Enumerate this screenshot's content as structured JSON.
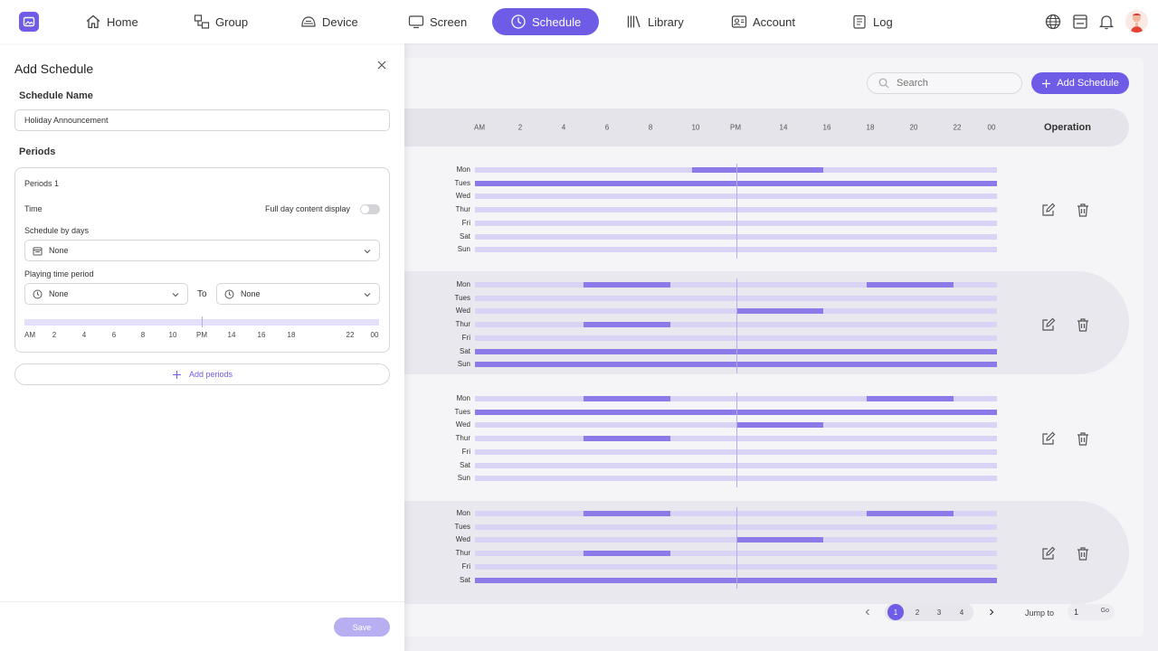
{
  "nav": {
    "items": [
      {
        "label": "Home",
        "icon": "home-icon"
      },
      {
        "label": "Group",
        "icon": "group-icon"
      },
      {
        "label": "Device",
        "icon": "device-icon"
      },
      {
        "label": "Screen",
        "icon": "screen-icon"
      },
      {
        "label": "Schedule",
        "icon": "clock-icon",
        "active": true
      },
      {
        "label": "Library",
        "icon": "library-icon"
      },
      {
        "label": "Account",
        "icon": "account-icon"
      },
      {
        "label": "Log",
        "icon": "log-icon"
      }
    ],
    "utility_icons": [
      "globe-icon",
      "inbox-icon",
      "bell-icon"
    ],
    "accent_color": "#6e5ce7"
  },
  "main": {
    "search_placeholder": "Search",
    "add_button_label": "Add Schedule",
    "timeline_ticks": [
      "AM",
      "2",
      "4",
      "6",
      "8",
      "10",
      "PM",
      "14",
      "16",
      "18",
      "20",
      "22",
      "00"
    ],
    "operation_header": "Operation",
    "day_labels": [
      "Mon",
      "Tues",
      "Wed",
      "Thur",
      "Fri",
      "Sat",
      "Sun"
    ],
    "schedules": [
      {
        "days": {
          "Mon": [
            [
              10,
              16
            ]
          ],
          "Tues": [
            [
              0,
              24
            ]
          ],
          "Wed": [],
          "Thur": [],
          "Fri": [],
          "Sat": [],
          "Sun": []
        }
      },
      {
        "days": {
          "Mon": [
            [
              5,
              9
            ],
            [
              18,
              22
            ]
          ],
          "Tues": [],
          "Wed": [
            [
              12,
              16
            ]
          ],
          "Thur": [
            [
              5,
              9
            ]
          ],
          "Fri": [],
          "Sat": [
            [
              0,
              24
            ]
          ],
          "Sun": [
            [
              0,
              24
            ]
          ]
        }
      },
      {
        "days": {
          "Mon": [
            [
              5,
              9
            ],
            [
              18,
              22
            ]
          ],
          "Tues": [
            [
              0,
              24
            ]
          ],
          "Wed": [
            [
              12,
              16
            ]
          ],
          "Thur": [
            [
              5,
              9
            ]
          ],
          "Fri": [],
          "Sat": [],
          "Sun": []
        }
      },
      {
        "days": {
          "Mon": [
            [
              5,
              9
            ],
            [
              18,
              22
            ]
          ],
          "Tues": [],
          "Wed": [
            [
              12,
              16
            ]
          ],
          "Thur": [
            [
              5,
              9
            ]
          ],
          "Fri": [],
          "Sat": [
            [
              0,
              24
            ]
          ]
        }
      }
    ],
    "pagination": {
      "pages": [
        "1",
        "2",
        "3",
        "4"
      ],
      "current": "1",
      "jump_label": "Jump to",
      "jump_value": "1",
      "go_label": "Go"
    }
  },
  "drawer": {
    "title": "Add Schedule",
    "schedule_name_label": "Schedule Name",
    "schedule_name_value": "Holiday Announcement",
    "periods_label": "Periods",
    "period": {
      "title": "Periods 1",
      "time_label": "Time",
      "full_day_label": "Full day content display",
      "full_day_enabled": false,
      "schedule_by_days_label": "Schedule by days",
      "schedule_by_days_value": "None",
      "playing_period_label": "Playing time period",
      "from_value": "None",
      "to_label": "To",
      "to_value": "None",
      "ticks": [
        "AM",
        "2",
        "4",
        "6",
        "8",
        "10",
        "PM",
        "14",
        "16",
        "18",
        "22",
        "00"
      ]
    },
    "add_periods_label": "Add periods",
    "save_label": "Save"
  }
}
